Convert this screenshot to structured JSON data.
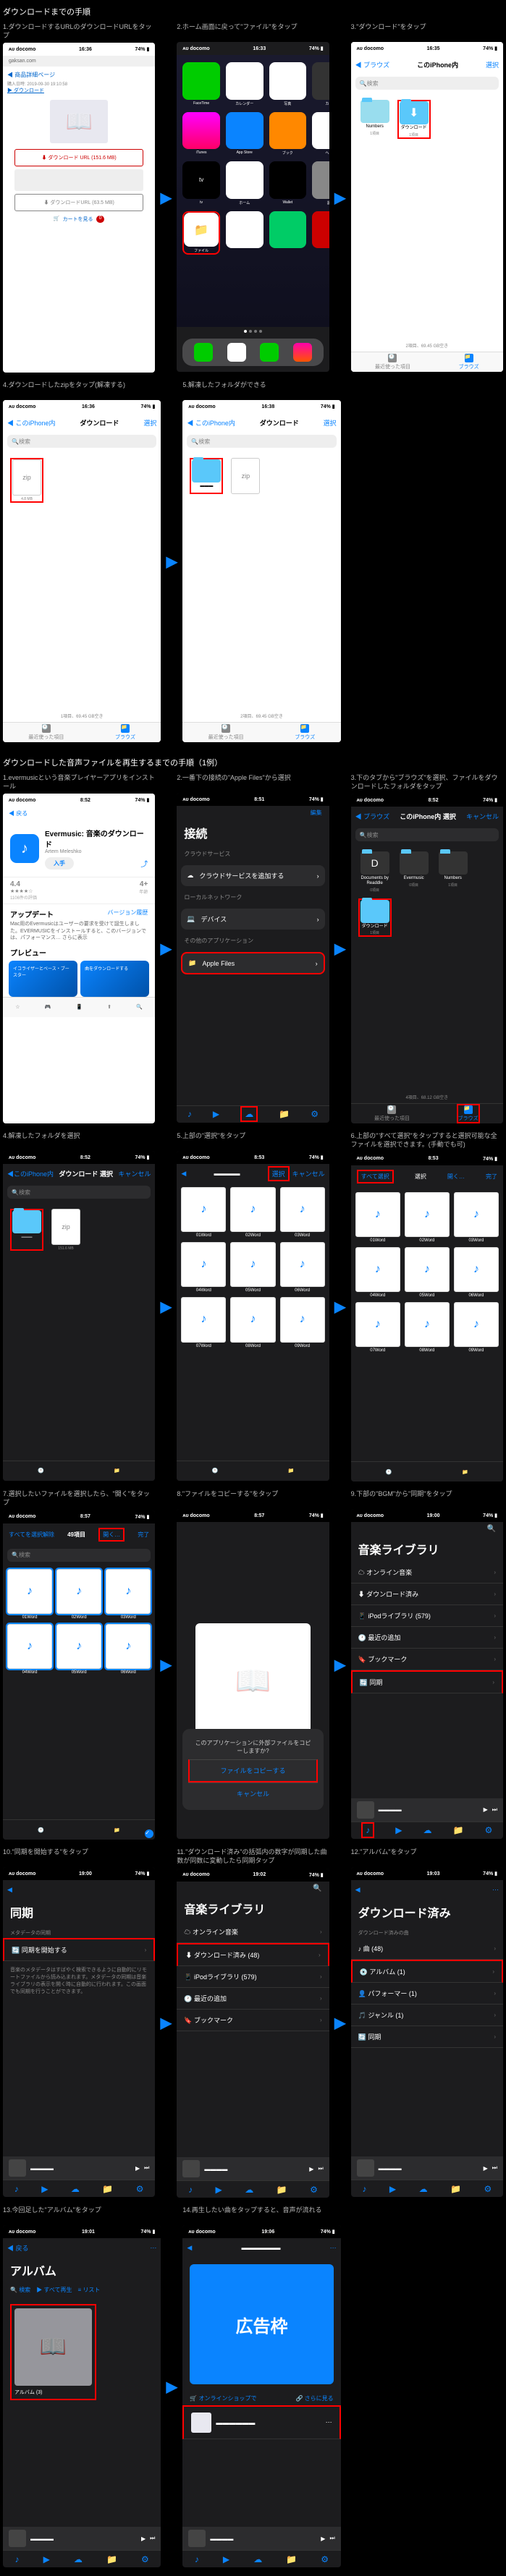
{
  "section1_title": "ダウンロードまでの手順",
  "section2_title": "ダウンロードした音声ファイルを再生するまでの手順（1例）",
  "statusbar": {
    "carrier": "ᴀᴜ docomo",
    "time_1636": "16:36",
    "time_1633": "16:33",
    "time_1635": "16:35",
    "time_1638": "16:38",
    "time_851": "8:51",
    "time_852": "8:52",
    "time_853": "8:53",
    "time_857": "8:57",
    "time_1900": "19:00",
    "time_1901": "19:01",
    "time_1902": "19:02",
    "time_1903": "19:03",
    "time_1906": "19:06",
    "battery": "74% ▮"
  },
  "steps": {
    "s1": "1.ダウンロードするURLのダウンロードURLをタップ",
    "s2": "2.ホーム画面に戻って\"ファイル\"をタップ",
    "s3": "3.\"ダウンロード\"をタップ",
    "s4": "4.ダウンロードしたzipをタップ(解凍する)",
    "s5": "5.解凍したフォルダができる",
    "p1": "1.evermusicという音楽プレイヤーアプリをインストール",
    "p2": "2.一番下の接続の\"Apple Files\"から選択",
    "p3": "3.下のタブから\"ブラウズ\"を選択、ファイルをダウンロードしたフォルダをタップ",
    "p4": "4.解凍したフォルダを選択",
    "p5": "5.上部の\"選択\"をタップ",
    "p6": "6.上部の\"すべて選択\"をタップすると選択可能な全ファイルを選択できます。(手動でも可)",
    "p7": "7.選択したいファイルを選択したら、\"開く\"をタップ",
    "p8": "8.\"ファイルをコピーする\"をタップ",
    "p9": "9.下部の\"BGM\"から\"同期\"をタップ",
    "p10": "10.\"同期を開始する\"をタップ",
    "p11": "11.\"ダウンロード済み\"の括弧内の数字が同期した曲数が同数に変動したら同期タップ",
    "p12": "12.\"アルバム\"をタップ",
    "p13": "13.今回足した\"アルバム\"をタップ",
    "p14": "14.再生したい曲をタップすると、音声が流れる"
  },
  "nav": {
    "browse": "ブラウズ",
    "iphone": "このiPhone内",
    "select": "選択",
    "download": "ダウンロード",
    "back": "戻る",
    "done": "完了",
    "cancel": "キャンセル",
    "select_all": "すべて選択",
    "open": "開く…"
  },
  "search": {
    "placeholder": "検索"
  },
  "screen1": {
    "header_link": "商品詳細ページ",
    "date": "購入日時: 2019-09-30 19:10:58",
    "dl_link": "ダウンロード",
    "button": "ダウンロード URL (151.6 MB)",
    "button2": "ダウンロードURL (63.5 MB)",
    "cart": "カートを見る",
    "count": "0"
  },
  "files": {
    "numbers": "Numbers",
    "downloads": "ダウンロード",
    "numbers_meta": "1項目",
    "dl_meta": "1項目",
    "storage": "2項目、69.45 GB空き",
    "storage1": "1項目、69.45 GB空き",
    "storage4": "4項目、68.12 GB空き",
    "zip": "zip",
    "zip_meta": "4.8 MB"
  },
  "homescreen": {
    "apps": [
      "FaceTime",
      "カレンダー",
      "写真",
      "カメラ",
      "iTunes",
      "App Store",
      "ブック",
      "ヘルス",
      "ホーム",
      "Wallet",
      "設定"
    ],
    "files_app": "ファイル",
    "tv": "tv"
  },
  "evermusic": {
    "name": "Evermusic: 音楽のダウンロード",
    "developer": "Artem Meleshko",
    "get": "入手",
    "rating": "4.4",
    "stars": "★★★★☆",
    "count": "1106件の評価",
    "age": "4+",
    "age_label": "年齢",
    "update": "アップデート",
    "version": "バージョン履歴",
    "desc": "Mac用のEvermusicはユーザーの要求を受けて誕生しました。EVERMUSICをインストールすると、このバージョンでは、パフォーマンス… さらに表示",
    "preview": "プレビュー",
    "card1": "イコライザーとベース・ブースター",
    "card2": "曲をダウンロードする"
  },
  "connect": {
    "title": "接続",
    "edit": "編集",
    "cloud_section": "クラウドサービス",
    "cloud_add": "クラウドサービスを追加する",
    "local": "ローカルネットワーク",
    "devices": "デバイス",
    "other": "その他のアプリケーション",
    "apple_files": "Apple Files"
  },
  "browse_screen": {
    "docs": "Documents by Readdle",
    "ever": "Evermusic",
    "numbers": "Numbers",
    "dl": "ダウンロード",
    "meta_0": "0項目",
    "meta_1": "1項目"
  },
  "wordfiles": [
    "01Word",
    "02Word",
    "03Word",
    "04Word",
    "05Word",
    "06Word",
    "07Word",
    "08Word",
    "09Word"
  ],
  "file_size": "151.6 MB",
  "selected_count": "49項目",
  "all_select_label": "すべてを選択解除",
  "dialog": {
    "title": "このアプリケーションに外部ファイルをコピーしますか?",
    "copy": "ファイルをコピーする",
    "cancel": "キャンセル"
  },
  "library": {
    "title": "音楽ライブラリ",
    "search": "検索",
    "online": "オンライン音楽",
    "downloaded": "ダウンロード済み",
    "downloaded_count": "ダウンロード済み (48)",
    "ipod": "iPodライブラリ (579)",
    "recent": "最近の追加",
    "bookmark": "ブックマーク",
    "sync": "同期"
  },
  "sync_screen": {
    "title": "同期",
    "meta": "メタデータの同期",
    "start": "同期を開始する",
    "desc": "音楽のメタデータはすばやく検索できるように自動的にリモートファイルから読み込まれます。メタデータの同期は音楽ライブラリの表示を開く時に自動的に行われます。この画面でも同期を行うことができます。"
  },
  "downloaded_screen": {
    "title": "ダウンロード済み",
    "subtitle": "ダウンロード済みの曲",
    "songs": "曲 (48)",
    "albums": "アルバム (1)",
    "artists": "パフォーマー (1)",
    "genres": "ジャンル (1)",
    "sync": "同期"
  },
  "album_screen": {
    "title": "アルバム",
    "back": "戻る",
    "play_all": "すべて再生",
    "list": "リスト",
    "album_name": "アルバム (3)"
  },
  "player": {
    "more": "さらに見る",
    "online_shop": "オンラインショップで"
  },
  "ad": "広告枠",
  "tabs": {
    "recent": "最近使った項目",
    "browse": "ブラウズ"
  }
}
